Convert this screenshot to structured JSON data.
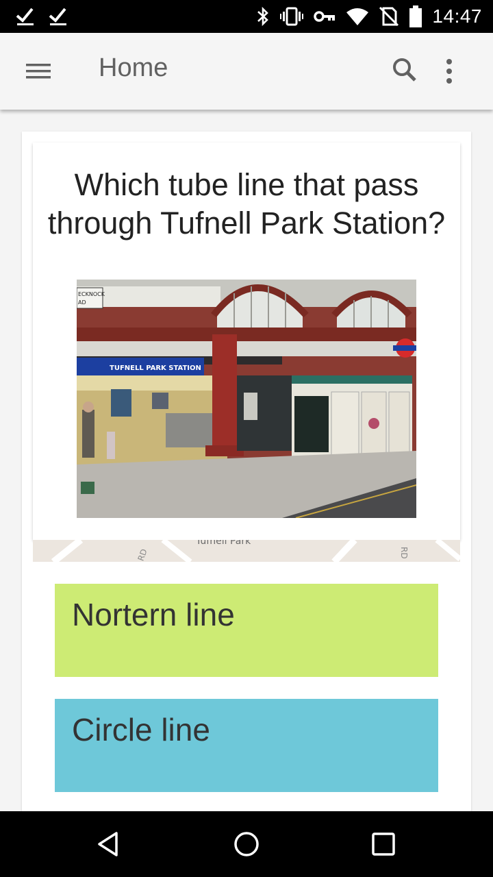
{
  "status_bar": {
    "time": "14:47",
    "icons": [
      "check-icon",
      "check-icon",
      "bluetooth-icon",
      "vibrate-icon",
      "vpn-key-icon",
      "wifi-icon",
      "no-sim-icon",
      "battery-icon"
    ]
  },
  "app_bar": {
    "title": "Home",
    "menu_icon": "hamburger-menu-icon",
    "search_icon": "search-icon",
    "more_icon": "more-vert-icon"
  },
  "question": {
    "text": "Which tube line that pass through Tufnell Park Station?",
    "photo": {
      "station_sign": "TUFNELL PARK STATION",
      "street_sign": "ECKNOCK AD",
      "roundel_text": "UNDERGROUND"
    }
  },
  "map_strip": {
    "label": "Tufnell Park",
    "road_left": "RD",
    "road_right": "RD"
  },
  "answers": [
    {
      "label": "Nortern line",
      "color": "#cdeb74"
    },
    {
      "label": "Circle line",
      "color": "#6ec8d9"
    }
  ],
  "nav_bar": {
    "back_icon": "back-triangle-icon",
    "home_icon": "home-circle-icon",
    "recents_icon": "recents-square-icon"
  }
}
